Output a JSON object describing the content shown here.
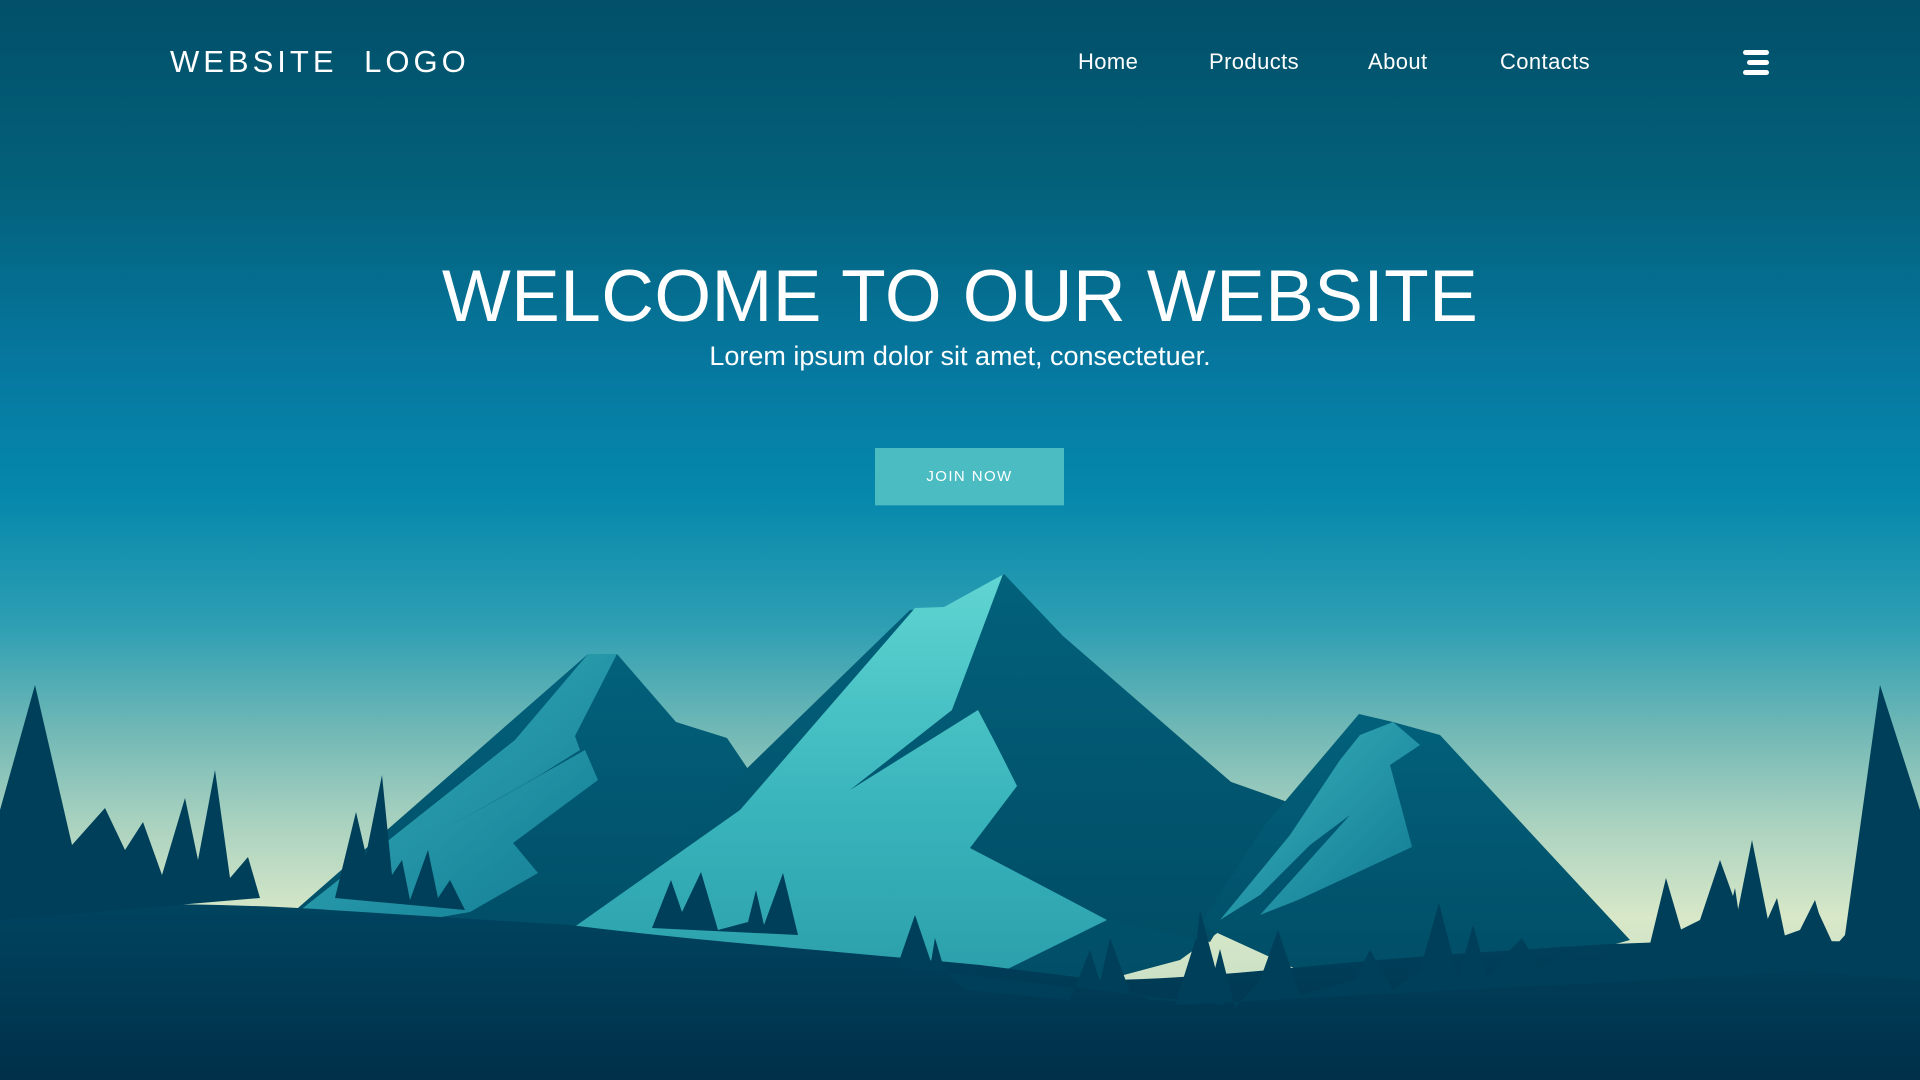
{
  "header": {
    "logo": "WEBSITE LOGO",
    "nav": [
      {
        "label": "Home"
      },
      {
        "label": "Products"
      },
      {
        "label": "About"
      },
      {
        "label": "Contacts"
      }
    ],
    "menu_icon": "hamburger-menu-icon"
  },
  "hero": {
    "title": "WELCOME TO OUR WEBSITE",
    "subtitle": "Lorem ipsum dolor sit amet, consectetuer.",
    "button_label": "JOIN NOW"
  },
  "colors": {
    "sky_top": "#02506a",
    "sky_mid": "#0588ac",
    "horizon_glow": "#d8e8c8",
    "button": "#4bbcc2",
    "mountain_light": "#5ccfcd",
    "mountain_dark": "#005d75",
    "foreground": "#003a52",
    "text": "#ffffff"
  }
}
